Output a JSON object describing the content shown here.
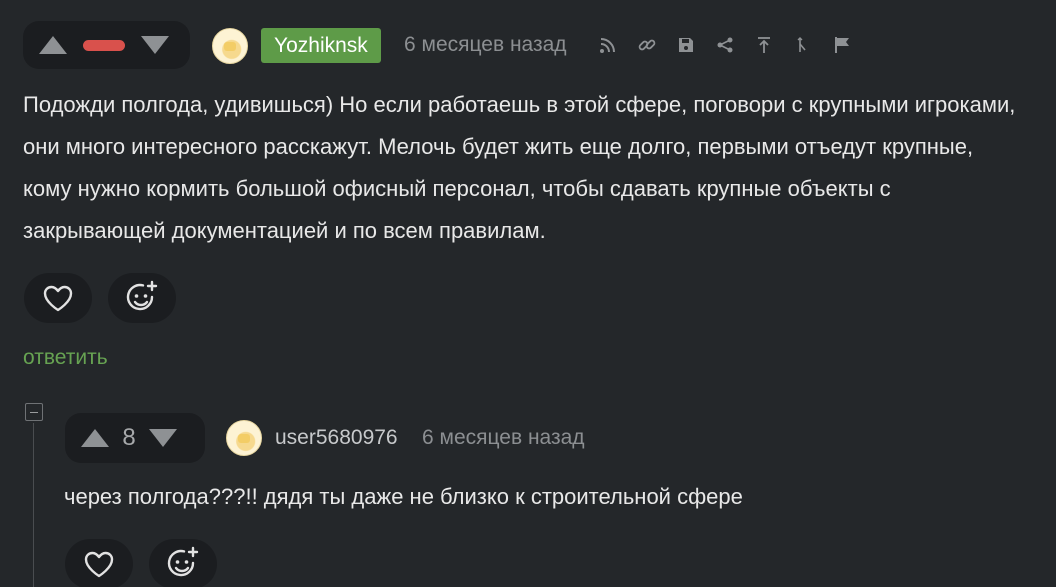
{
  "comment1": {
    "author": "Yozhiknsk",
    "time": "6 месяцев назад",
    "text": "Подожди полгода, удивишься) Но если работаешь в этой сфере, поговори с крупными игроками, они много интересного расскажут. Мелочь будет жить еще долго, первыми отъедут крупные, кому нужно кормить большой офисный персонал, чтобы сдавать крупные объекты с закрывающей документацией и по всем правилам.",
    "reply_label": "ответить"
  },
  "comment2": {
    "author": "user5680976",
    "time": "6 месяцев назад",
    "votes": "8",
    "text": "через полгода???!! дядя ты даже не близко к строительной сфере"
  },
  "colors": {
    "background": "#24272a",
    "widget_bg": "#1b1d20",
    "author_badge": "#5e9b48",
    "reply_link": "#67a352",
    "negative_bar": "#d9514c"
  },
  "icons": [
    "arrow-up-icon",
    "arrow-down-icon",
    "rss-icon",
    "link-icon",
    "save-icon",
    "share-icon",
    "pin-to-top-icon",
    "hide-icon",
    "report-flag-icon",
    "heart-icon",
    "emoji-add-icon"
  ]
}
